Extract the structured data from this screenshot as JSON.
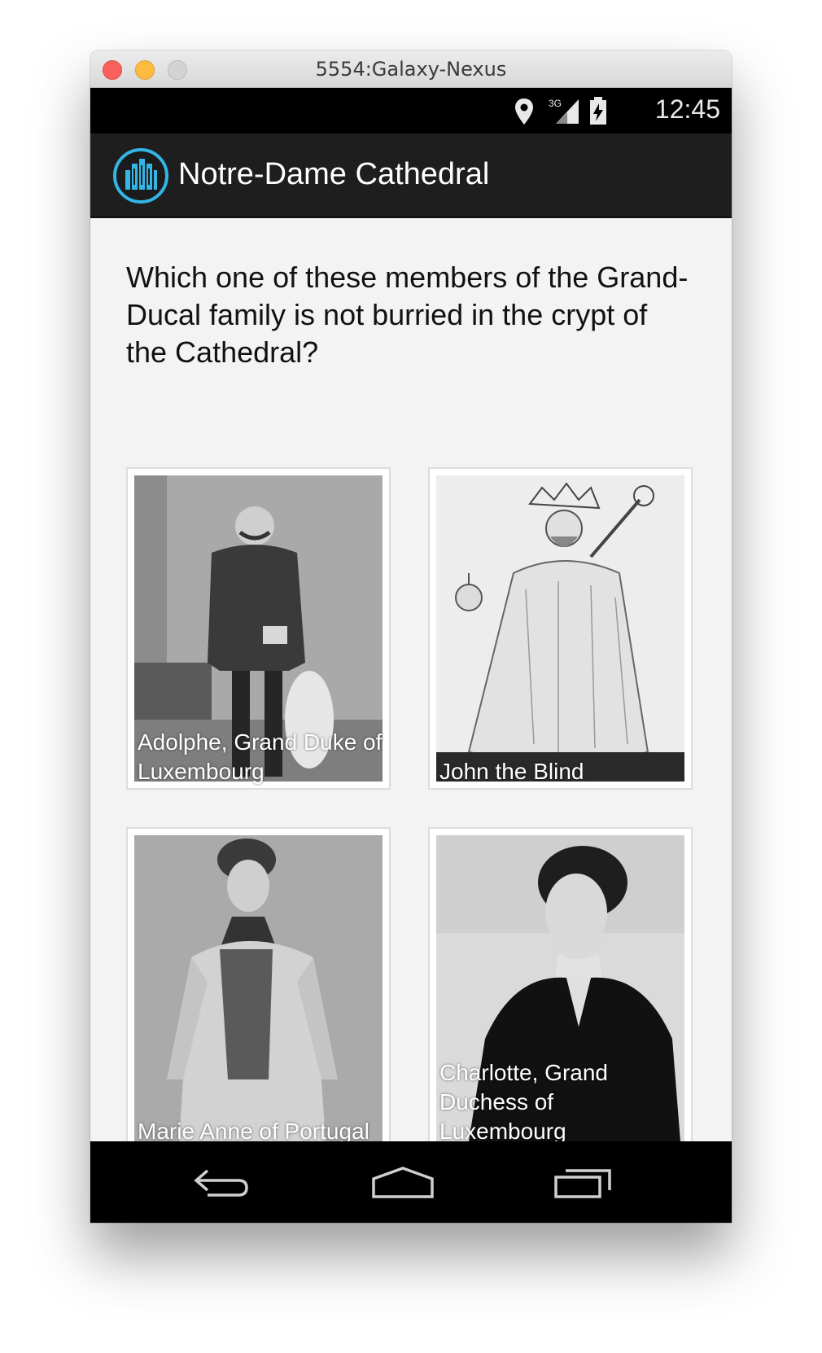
{
  "window": {
    "title": "5554:Galaxy-Nexus"
  },
  "status_bar": {
    "time": "12:45",
    "network_label": "3G",
    "icons": [
      "location-pin-icon",
      "signal-3g-icon",
      "battery-icon"
    ]
  },
  "action_bar": {
    "app_icon": "cathedral-app-icon",
    "title": "Notre-Dame Cathedral",
    "accent_color": "#33b5e5"
  },
  "quiz": {
    "question": "Which one of these members of the Grand-Ducal family is not burried in the crypt of the Cathedral?",
    "options": [
      {
        "caption": "Adolphe, Grand Duke of Luxembourg"
      },
      {
        "caption": "John the Blind"
      },
      {
        "caption": "Marie Anne of Portugal"
      },
      {
        "caption": "Charlotte, Grand Duchess of Luxembourg"
      }
    ]
  },
  "nav_bar": {
    "icons": [
      "back-icon",
      "home-icon",
      "recent-apps-icon"
    ]
  }
}
